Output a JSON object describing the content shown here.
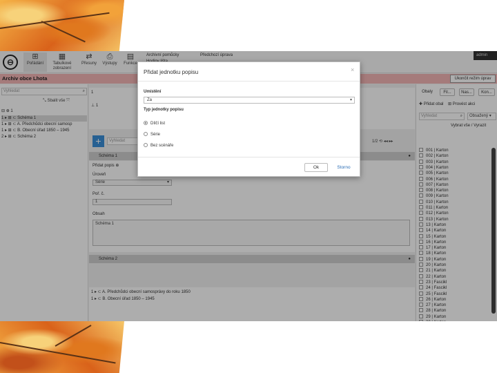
{
  "toolbar": {
    "logo_glyph": "⊖",
    "buttons": [
      {
        "label": "Pořádání",
        "icon": "sitemap-icon",
        "glyph": "⊞"
      },
      {
        "label": "Tabulkové zobrazení",
        "icon": "table-icon",
        "glyph": "▦"
      },
      {
        "label": "Přesuny",
        "icon": "exchange-icon",
        "glyph": "⇄"
      },
      {
        "label": "Výstupy",
        "icon": "printer-icon",
        "glyph": "⎙"
      },
      {
        "label": "Funkce",
        "icon": "calculator-icon",
        "glyph": "▤"
      }
    ],
    "archive_aids_label": "Archivní pomůcky",
    "second_menu_label": "Hodiny lišta",
    "previous_aid_label": "Předchozí úprava",
    "admin_label": "admin"
  },
  "archive_bar": {
    "title": "Archiv obce Lhota",
    "end_mode_button": "Ukončit režim úprav"
  },
  "left_panel": {
    "search_placeholder": "Vyhledat",
    "collapse_all": "Sbalit vše",
    "tree": [
      "⊟ ⊕ 1",
      "1 ▸ ⊞  ⊂ Schéma 1",
      "1 ▸ ⊞  ⊂ A. Předchůdci obecní samosp",
      "1 ▸ ⊞  ⊂ B. Obecní úřad 1850 – 1945",
      "2 ▸ ⊞  ⊂ Schéma 2"
    ]
  },
  "center_panel": {
    "top_label_1": "1",
    "top_label_2": "⊥ 1",
    "search_placeholder": "Vyhledat",
    "pager_text": "1/2 ⟲  ◂◂  ▸▸",
    "section_1_title": "Schéma 1",
    "subheader": "Přidat popis ⊕",
    "field_oznaceni": "Úroveň",
    "field_oznaceni_value": "Série",
    "field_poradi": "Poř. č.",
    "field_poradi_value": "1",
    "field_obsah": "Obsah",
    "field_obsah_value": "Schéma 1",
    "section_2_title": "Schéma 2",
    "bottom_rows": [
      "1 ▸ ⊂ A. Předchůdci obecní samosprávy do roku 1850",
      "1 ▸ ⊂ B. Obecní úřad 1850 – 1945"
    ]
  },
  "right_panel": {
    "tab_label": "Obaly",
    "tab_buttons": [
      "Fil...",
      "Nas...",
      "Kon..."
    ],
    "add_link": "✚ Přidat obal",
    "action_link": "⊞ Provést akci",
    "search_placeholder": "Vyhledat",
    "filter_value": "Obsažený",
    "select_all_link": "Vybrat vše / Vyrazit",
    "items": [
      "001 | Karton",
      "002 | Karton",
      "003 | Karton",
      "004 | Karton",
      "005 | Karton",
      "006 | Karton",
      "007 | Karton",
      "008 | Karton",
      "009 | Karton",
      "010 | Karton",
      "011 | Karton",
      "012 | Karton",
      "013 | Karton",
      "13 | Karton",
      "14 | Karton",
      "15 | Karton",
      "16 | Karton",
      "17 | Karton",
      "18 | Karton",
      "19 | Karton",
      "20 | Karton",
      "21 | Karton",
      "22 | Karton",
      "23 | Fascikl",
      "24 | Fascikl",
      "25 | Fascikl",
      "26 | Karton",
      "27 | Karton",
      "28 | Karton",
      "29 | Karton",
      "30 | Karton"
    ]
  },
  "modal": {
    "title": "Přidat jednotku popisu",
    "close_glyph": "×",
    "placement_label": "Umístění",
    "placement_value": "Za",
    "type_label": "Typ jednotky popisu",
    "options": [
      {
        "label": "Dílčí list",
        "selected": true
      },
      {
        "label": "Série",
        "selected": false
      },
      {
        "label": "Bez scénáře",
        "selected": false
      }
    ],
    "ok_button": "Ok",
    "cancel_button": "Storno"
  },
  "colors": {
    "archive_bar": "#f4b5b5",
    "add_button": "#3a8ed8",
    "cancel_link": "#2a6db5"
  }
}
